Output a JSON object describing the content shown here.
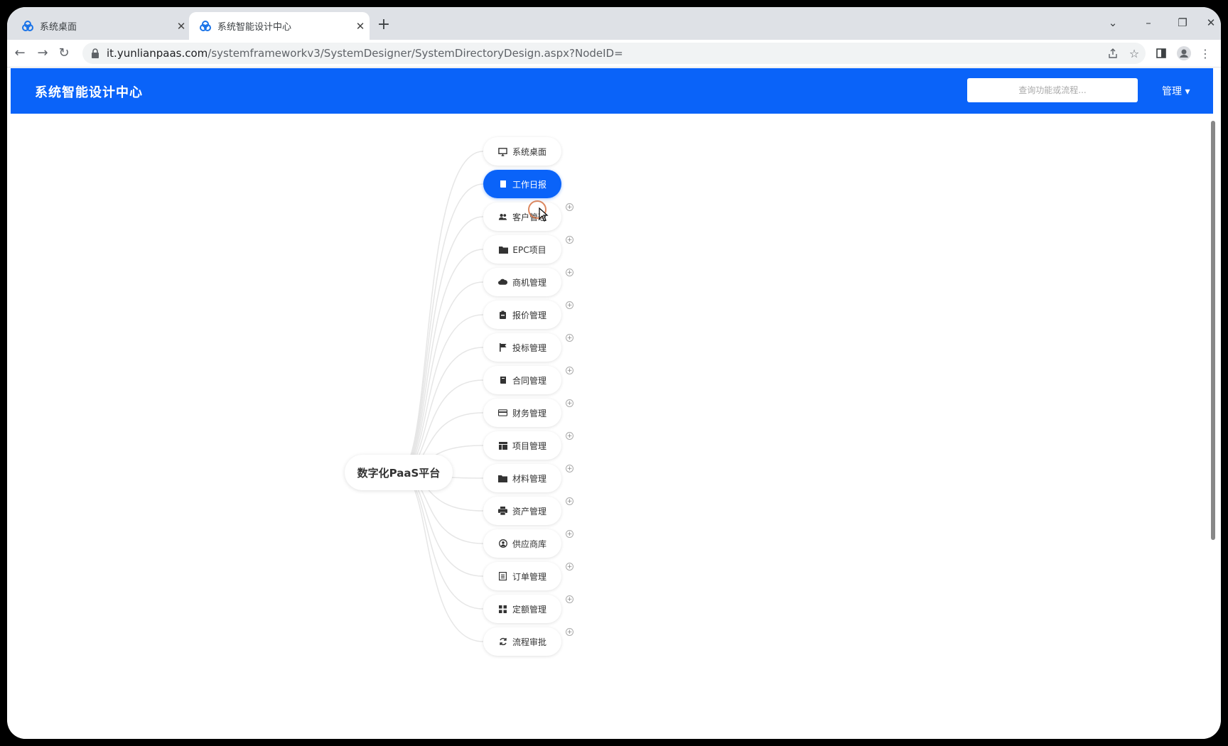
{
  "browser": {
    "tabs": [
      {
        "title": "系统桌面",
        "active": false
      },
      {
        "title": "系统智能设计中心",
        "active": true
      }
    ],
    "url_host": "it.yunlianpaas.com",
    "url_path": "/systemframeworkv3/SystemDesigner/SystemDirectoryDesign.aspx?NodeID=",
    "new_tab": "+",
    "close_glyph": "✕"
  },
  "app": {
    "title": "系统智能设计中心",
    "search_placeholder": "查询功能或流程...",
    "manage_label": "管理 ▾"
  },
  "mindmap": {
    "root": "数字化PaaS平台",
    "nodes": [
      {
        "label": "系统桌面",
        "icon": "monitor-icon",
        "expandable": false,
        "selected": false
      },
      {
        "label": "工作日报",
        "icon": "book-icon",
        "expandable": false,
        "selected": true
      },
      {
        "label": "客户管理",
        "icon": "users-icon",
        "expandable": true,
        "selected": false
      },
      {
        "label": "EPC项目",
        "icon": "folder-icon",
        "expandable": true,
        "selected": false
      },
      {
        "label": "商机管理",
        "icon": "cloud-icon",
        "expandable": true,
        "selected": false
      },
      {
        "label": "报价管理",
        "icon": "clipboard-icon",
        "expandable": true,
        "selected": false
      },
      {
        "label": "投标管理",
        "icon": "flag-icon",
        "expandable": true,
        "selected": false
      },
      {
        "label": "合同管理",
        "icon": "book-icon",
        "expandable": true,
        "selected": false
      },
      {
        "label": "财务管理",
        "icon": "credit-card-icon",
        "expandable": true,
        "selected": false
      },
      {
        "label": "项目管理",
        "icon": "table-icon",
        "expandable": true,
        "selected": false
      },
      {
        "label": "材料管理",
        "icon": "folder-icon",
        "expandable": true,
        "selected": false
      },
      {
        "label": "资产管理",
        "icon": "printer-icon",
        "expandable": true,
        "selected": false
      },
      {
        "label": "供应商库",
        "icon": "user-circle-icon",
        "expandable": true,
        "selected": false
      },
      {
        "label": "订单管理",
        "icon": "list-icon",
        "expandable": true,
        "selected": false
      },
      {
        "label": "定额管理",
        "icon": "grid-icon",
        "expandable": true,
        "selected": false
      },
      {
        "label": "流程审批",
        "icon": "refresh-icon",
        "expandable": true,
        "selected": false
      }
    ]
  },
  "colors": {
    "accent": "#0a63f9",
    "tabbar": "#dee1e6"
  }
}
